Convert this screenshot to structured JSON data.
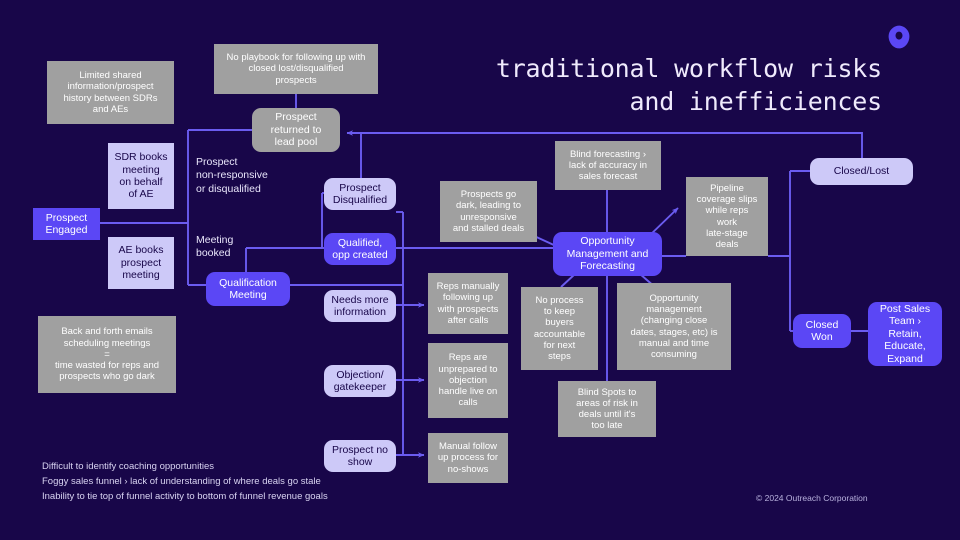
{
  "title": "traditional workflow risks\nand inefficiences",
  "brand": {
    "logo_icon": "outreach-logo-icon",
    "copyright": "© 2024 Outreach Corporation",
    "colors": {
      "background": "#180649",
      "accent_purple": "#5b47f5",
      "light_lavender": "#cdc9f8",
      "risk_gray": "#a0a0a0",
      "wire": "#6b5cf0"
    }
  },
  "footnotes": [
    "Difficult to identify coaching opportunities",
    "Foggy sales funnel › lack of understanding of where deals go stale",
    "Inability to tie top of funnel activity to bottom of funnel revenue goals"
  ],
  "edge_labels": [
    {
      "id": "non-responsive",
      "text": "Prospect\nnon-responsive\nor disqualified"
    },
    {
      "id": "meeting-booked",
      "text": "Meeting\nbooked"
    }
  ],
  "nodes": [
    {
      "id": "limited-shared-information",
      "kind": "risk",
      "text": "Limited shared\ninformation/prospect\nhistory  between SDRs\nand AEs"
    },
    {
      "id": "no-playbook",
      "kind": "risk",
      "text": "No playbook for following up with\nclosed lost/disqualified\nprospects"
    },
    {
      "id": "prospect-returned-to-lead-pool",
      "kind": "risk-r",
      "text": "Prospect\nreturned  to\nlead pool"
    },
    {
      "id": "sdr-books-meeting",
      "kind": "stage-sq",
      "text": "SDR books\nmeeting\non behalf\nof AE"
    },
    {
      "id": "ae-books-prospect-meeting",
      "kind": "stage-sq",
      "text": "AE books\nprospect\nmeeting"
    },
    {
      "id": "prospect-engaged",
      "kind": "active-sq",
      "text": "Prospect\nEngaged"
    },
    {
      "id": "qualification-meeting",
      "kind": "active",
      "text": "Qualification\nMeeting"
    },
    {
      "id": "back-and-forth-emails",
      "kind": "risk",
      "text": "Back and forth emails\nscheduling meetings\n=\ntime wasted for reps and\nprospects who  go dark"
    },
    {
      "id": "prospect-disqualified",
      "kind": "stage",
      "text": "Prospect\nDisqualified"
    },
    {
      "id": "qualified-opp-created",
      "kind": "active",
      "text": "Qualified,\nopp created"
    },
    {
      "id": "needs-more-information",
      "kind": "stage",
      "text": "Needs more\ninformation"
    },
    {
      "id": "objection-gatekeeper",
      "kind": "stage",
      "text": "Objection/\ngatekeeper"
    },
    {
      "id": "prospect-no-show",
      "kind": "stage",
      "text": "Prospect no\nshow"
    },
    {
      "id": "prospects-go-dark",
      "kind": "risk",
      "text": "Prospects go\ndark, leading to\nunresponsive\nand stalled deals"
    },
    {
      "id": "reps-manually-following-up",
      "kind": "risk",
      "text": "Reps manually\nfollowing up\nwith prospects\nafter calls"
    },
    {
      "id": "reps-unprepared-objection",
      "kind": "risk",
      "text": "Reps are\nunprepared to\nobjection\nhandle live on\ncalls"
    },
    {
      "id": "manual-follow-up-no-shows",
      "kind": "risk",
      "text": "Manual  follow\nup process for\nno-shows"
    },
    {
      "id": "blind-forecasting",
      "kind": "risk",
      "text": "Blind forecasting ›\nlack of accuracy  in\nsales forecast"
    },
    {
      "id": "opportunity-management-forecasting",
      "kind": "active",
      "text": "Opportunity\nManagement and\nForecasting"
    },
    {
      "id": "pipeline-coverage-slips",
      "kind": "risk",
      "text": "Pipeline\ncoverage slips\nwhile reps\nwork\nlate-stage\ndeals"
    },
    {
      "id": "no-process-buyers-accountable",
      "kind": "risk",
      "text": "No process\nto keep\nbuyers\naccountable\nfor next\nsteps"
    },
    {
      "id": "opportunity-management-manual",
      "kind": "risk",
      "text": "Opportunity\nmanagement\n(changing close\ndates, stages, etc) is\nmanual and time\nconsuming"
    },
    {
      "id": "blind-spots-areas-of-risk",
      "kind": "risk",
      "text": "Blind Spots to\nareas of risk in\ndeals until it's\ntoo late"
    },
    {
      "id": "closed-lost",
      "kind": "stage",
      "text": "Closed/Lost"
    },
    {
      "id": "closed-won",
      "kind": "active",
      "text": "Closed\nWon"
    },
    {
      "id": "post-sales-team",
      "kind": "active",
      "text": "Post Sales\nTeam ›\nRetain,\nEducate,\nExpand"
    }
  ]
}
